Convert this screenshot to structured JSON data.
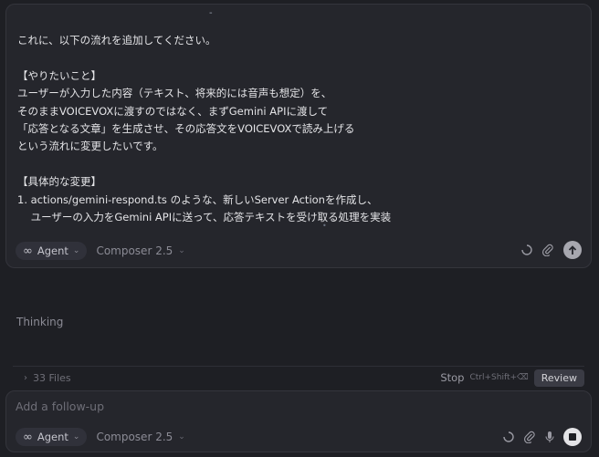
{
  "message": {
    "lines": [
      "これに、以下の流れを追加してください。",
      "",
      "【やりたいこと】",
      "ユーザーが入力した内容（テキスト、将来的には音声も想定）を、",
      "そのままVOICEVOXに渡すのではなく、まずGemini APIに渡して",
      "「応答となる文章」を生成させ、その応答文をVOICEVOXで読み上げる",
      "という流れに変更したいです。",
      "",
      "【具体的な変更】",
      "1. actions/gemini-respond.ts のような、新しいServer Actionを作成し、",
      "    ユーザーの入力をGemini APIに送って、応答テキストを受け取る処理を実装"
    ]
  },
  "composer_top": {
    "mode_label": "Agent",
    "model_label": "Composer 2.5"
  },
  "status": {
    "thinking_label": "Thinking"
  },
  "files_bar": {
    "files_label": "33 Files",
    "stop_label": "Stop",
    "stop_shortcut": "Ctrl+Shift+⌫",
    "review_label": "Review"
  },
  "follow_up": {
    "placeholder": "Add a follow-up",
    "mode_label": "Agent",
    "model_label": "Composer 2.5"
  },
  "icons": {
    "mode": "infinity-icon",
    "loading": "spinner-icon",
    "attach": "paperclip-icon",
    "send": "arrow-up-icon",
    "mic": "microphone-icon",
    "stop": "stop-icon",
    "chevron": "chevron-down-icon",
    "files": "chevron-right-icon"
  }
}
